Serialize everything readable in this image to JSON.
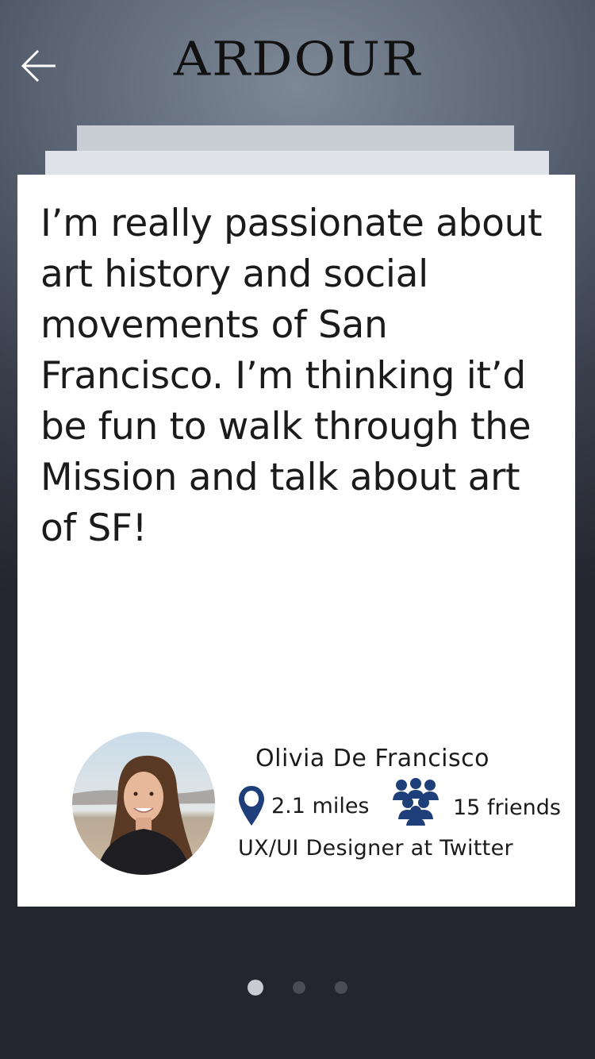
{
  "header": {
    "title": "ARDOUR"
  },
  "card": {
    "quote": "I’m really passionate about art history and social movements of San Francisco. I’m thinking it’d be fun to walk through the Mission and talk about art of SF!",
    "profile": {
      "name": "Olivia De Francisco",
      "distance": "2.1 miles",
      "friends": "15 friends",
      "job": "UX/UI Designer at Twitter"
    }
  },
  "pagination": {
    "count": 3,
    "active_index": 0
  },
  "colors": {
    "icon_blue": "#1f3f7a",
    "card_bg": "#ffffff"
  }
}
